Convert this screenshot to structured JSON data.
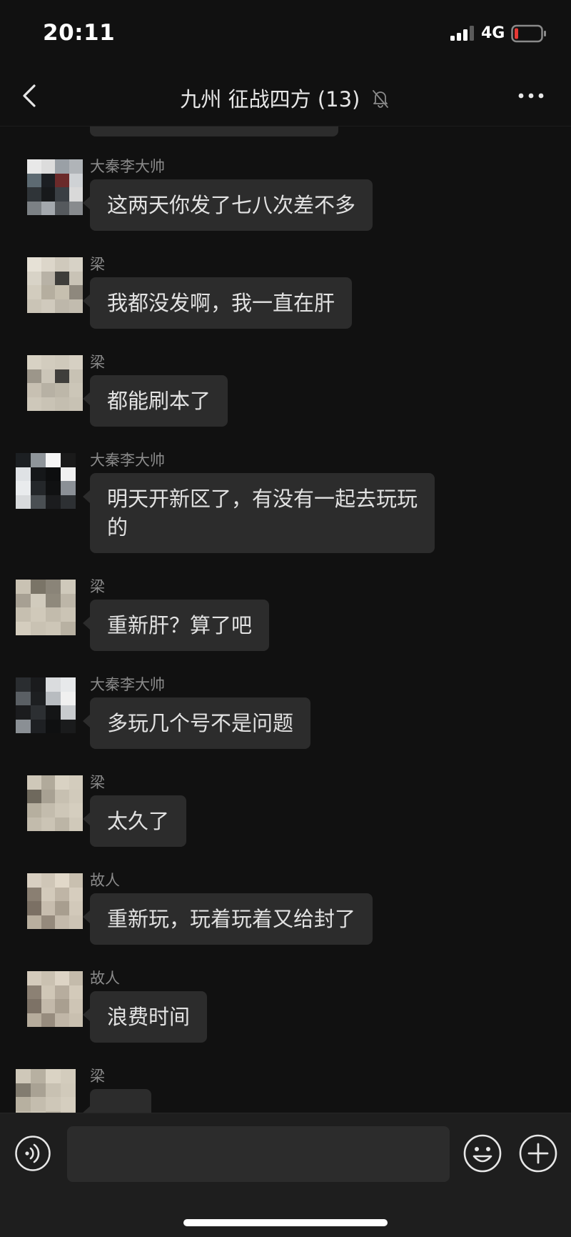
{
  "status_bar": {
    "time": "20:11",
    "network": "4G",
    "battery_color": "#e53935"
  },
  "nav": {
    "title": "九州 征战四方",
    "member_count": "(13)",
    "back_icon": "chevron-left-icon",
    "more_icon": "more-dots-icon",
    "muted_icon": "bell-muted-icon"
  },
  "messages": [
    {
      "sender": "大秦李大帅",
      "lines": [
        "这两天你发了七八次差不多"
      ],
      "avatar": [
        "#e8e8e8",
        "#dcdcdc",
        "#9aa0a6",
        "#b0b4b8",
        "#5d6a72",
        "#1b1e22",
        "#6b2a2a",
        "#cfd2d5",
        "#2f3438",
        "#17191b",
        "#3a3f44",
        "#d9d9d9",
        "#7c8185",
        "#a3a8ad",
        "#55595d",
        "#888b8e"
      ]
    },
    {
      "sender": "梁",
      "lines": [
        "我都没发啊，我一直在肝"
      ],
      "avatar": [
        "#e6e1d6",
        "#dcd6ca",
        "#cfc9bc",
        "#d7d2c6",
        "#d8d3c7",
        "#b8b2a6",
        "#3e3d3a",
        "#c9c3b6",
        "#d2ccbe",
        "#b5ae9f",
        "#c6bfaf",
        "#8e887d",
        "#cac4b6",
        "#d0cabd",
        "#bdb7aa",
        "#c2bcaf"
      ]
    },
    {
      "sender": "梁",
      "lines": [
        "都能刷本了"
      ],
      "avatar": [
        "#d8d2c4",
        "#d2ccbe",
        "#cfc9bb",
        "#d6d0c3",
        "#9c968a",
        "#cbc5b8",
        "#3f3e3b",
        "#c8c2b4",
        "#c7c0b2",
        "#b7b1a4",
        "#bdb7a9",
        "#ccc6b8",
        "#cec8ba",
        "#c9c3b5",
        "#c4beb0",
        "#c8c2b4"
      ]
    },
    {
      "sender": "大秦李大帅",
      "lines": [
        "明天开新区了，有没有一起去玩玩",
        "的"
      ],
      "avatar": [
        "#1c1f22",
        "#8f959a",
        "#f5f5f5",
        "#1a1a1a",
        "#dfe2e5",
        "#151719",
        "#0d0e0f",
        "#f0f0f0",
        "#e9ebed",
        "#24272a",
        "#101112",
        "#8b9096",
        "#d8dadc",
        "#4a4f53",
        "#1b1c1e",
        "#2d3033"
      ]
    },
    {
      "sender": "梁",
      "lines": [
        "重新肝？算了吧"
      ],
      "avatar": [
        "#c9c2b3",
        "#7a7467",
        "#8a8478",
        "#cfc9bb",
        "#a7a093",
        "#d1cbbd",
        "#8f897c",
        "#bdb6a8",
        "#c6bfb0",
        "#d0c9ba",
        "#c2bbac",
        "#cbc4b5",
        "#d4cdbe",
        "#c9c2b3",
        "#cdc6b7",
        "#b8b1a2"
      ]
    },
    {
      "sender": "大秦李大帅",
      "lines": [
        "多玩几个号不是问题"
      ],
      "avatar": [
        "#2a2d30",
        "#1a1b1d",
        "#dadcde",
        "#e7e9eb",
        "#5a5f64",
        "#1d1f21",
        "#b8bcc0",
        "#f0f0f0",
        "#1b1c1e",
        "#2c2f32",
        "#141516",
        "#c8cbce",
        "#8a8f94",
        "#1e2023",
        "#0f1011",
        "#1a1b1c"
      ]
    },
    {
      "sender": "梁",
      "lines": [
        "太久了"
      ],
      "avatar": [
        "#cfc8b9",
        "#b1aa9b",
        "#d9d2c3",
        "#d3ccbd",
        "#6f695d",
        "#a8a193",
        "#c7c0b1",
        "#d1cabb",
        "#b6af9f",
        "#c3bcad",
        "#cec7b8",
        "#d5cebf",
        "#c2bbac",
        "#cbc4b5",
        "#bcb5a6",
        "#d0c9ba"
      ]
    },
    {
      "sender": "故人",
      "lines": [
        "重新玩，玩着玩着又给封了"
      ],
      "avatar": [
        "#d8cfc1",
        "#cfc6b7",
        "#e1d8c9",
        "#c9c0b0",
        "#8a7f72",
        "#d3cabb",
        "#bfb5a6",
        "#d6cdbe",
        "#7b7064",
        "#c7bdae",
        "#a89e8f",
        "#d2c9ba",
        "#b9af9f",
        "#958a7c",
        "#c4baab",
        "#cdc4b5"
      ]
    },
    {
      "sender": "故人",
      "lines": [
        "浪费时间"
      ],
      "avatar": [
        "#d4cbbc",
        "#cac1b1",
        "#ddd4c5",
        "#c4bbab",
        "#8c8174",
        "#d0c7b7",
        "#b7ad9e",
        "#d3caba",
        "#7d7266",
        "#c3b9aa",
        "#a99f90",
        "#cec5b5",
        "#b6ac9c",
        "#978c7e",
        "#c0b6a7",
        "#c9c0b0"
      ]
    },
    {
      "sender": "梁",
      "lines": [
        ""
      ],
      "avatar": [
        "#cfc8b9",
        "#b7b0a1",
        "#dad3c4",
        "#d3ccbd",
        "#827c70",
        "#a9a294",
        "#c8c1b2",
        "#d1cabb",
        "#b7b0a0",
        "#c4bdae",
        "#cec7b8",
        "#d5cebf",
        "#c3bcad",
        "#ccc5b6",
        "#bdb6a7",
        "#d0c9ba"
      ]
    }
  ],
  "input": {
    "placeholder": "",
    "voice_icon": "voice-icon",
    "emoji_icon": "smiley-icon",
    "plus_icon": "plus-circle-icon"
  }
}
